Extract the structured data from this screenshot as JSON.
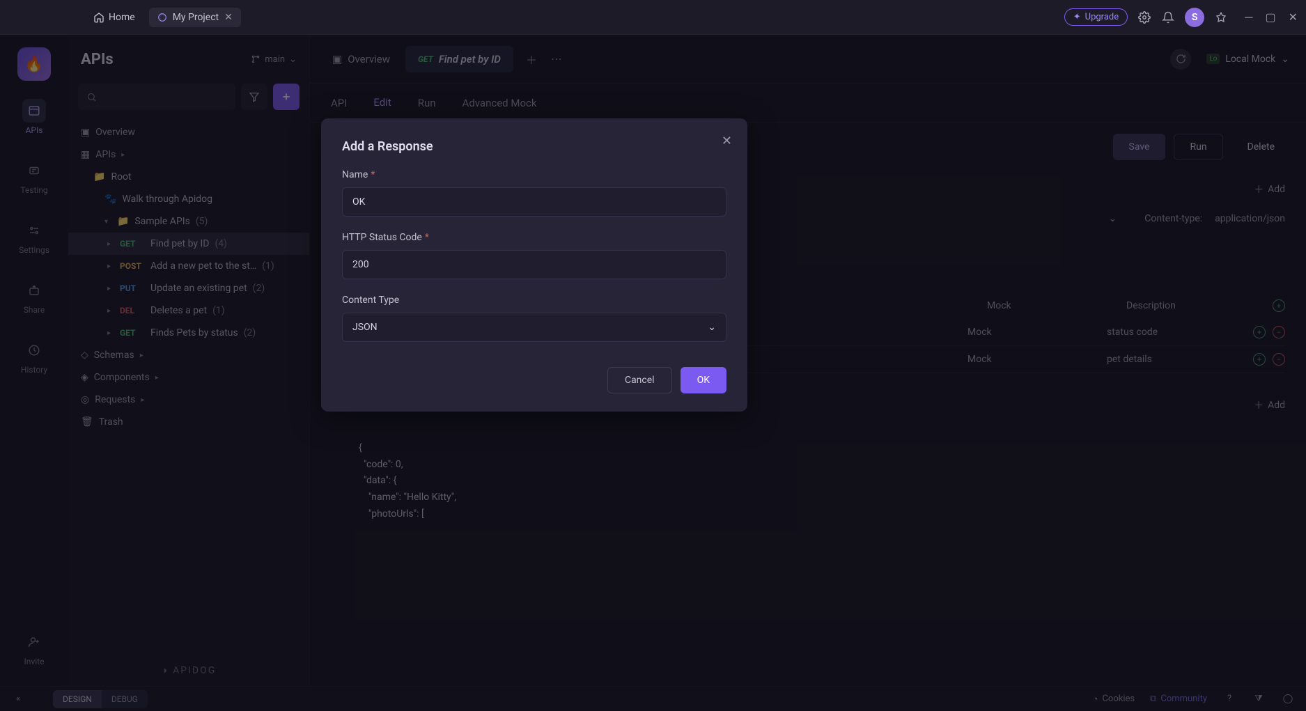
{
  "titlebar": {
    "home": "Home",
    "project_tab": "My Project",
    "upgrade": "Upgrade",
    "avatar_initial": "S"
  },
  "rail": {
    "items": [
      "APIs",
      "Testing",
      "Settings",
      "Share",
      "History"
    ],
    "invite": "Invite"
  },
  "sidebar": {
    "title": "APIs",
    "branch": "main",
    "sections": {
      "overview": "Overview",
      "apis": "APIs",
      "schemas": "Schemas",
      "components": "Components",
      "requests": "Requests",
      "trash": "Trash"
    },
    "tree": {
      "root": "Root",
      "walk": "Walk through Apidog",
      "sample": "Sample APIs",
      "sample_count": "(5)",
      "endpoints": [
        {
          "method": "GET",
          "name": "Find pet by ID",
          "count": "(4)"
        },
        {
          "method": "POST",
          "name": "Add a new pet to the st…",
          "count": "(1)"
        },
        {
          "method": "PUT",
          "name": "Update an existing pet",
          "count": "(2)"
        },
        {
          "method": "DEL",
          "name": "Deletes a pet",
          "count": "(1)"
        },
        {
          "method": "GET",
          "name": "Finds Pets by status",
          "count": "(2)"
        }
      ]
    },
    "brand": "APIDOG"
  },
  "content_tabs": {
    "overview": "Overview",
    "active": {
      "method": "GET",
      "name": "Find pet by ID"
    }
  },
  "environment": {
    "badge": "Lo",
    "name": "Local Mock"
  },
  "subtabs": [
    "API",
    "Edit",
    "Run",
    "Advanced Mock"
  ],
  "active_subtab": "Edit",
  "actions": {
    "save": "Save",
    "run": "Run",
    "delete": "Delete"
  },
  "add_label": "Add",
  "meta": {
    "content_type_label": "Content-type:",
    "content_type_value": "application/json"
  },
  "table": {
    "header_mock": "Mock",
    "header_desc": "Description",
    "rows": [
      {
        "mock": "Mock",
        "desc": "status code"
      },
      {
        "mock": "Mock",
        "desc": "pet details"
      }
    ],
    "add": "Add"
  },
  "code": {
    "l1": "{",
    "l2": "  \"code\": 0,",
    "l3": "  \"data\": {",
    "l4": "    \"name\": \"Hello Kitty\",",
    "l5": "    \"photoUrls\": ["
  },
  "statusbar": {
    "design": "DESIGN",
    "debug": "DEBUG",
    "cookies": "Cookies",
    "community": "Community"
  },
  "modal": {
    "title": "Add a Response",
    "name_label": "Name",
    "name_value": "OK",
    "status_label": "HTTP Status Code",
    "status_value": "200",
    "ctype_label": "Content Type",
    "ctype_value": "JSON",
    "cancel": "Cancel",
    "ok": "OK"
  }
}
